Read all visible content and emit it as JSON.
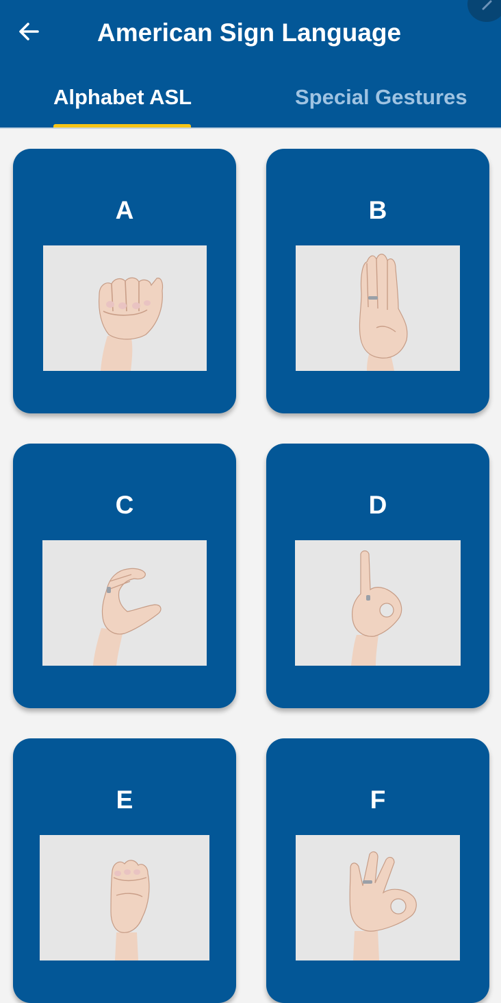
{
  "header": {
    "title": "American Sign Language",
    "back_icon": "arrow-left-icon",
    "corner_icon": "pencil-icon"
  },
  "tabs": [
    {
      "label": "Alphabet ASL",
      "selected": true
    },
    {
      "label": "Special Gestures",
      "selected": false
    }
  ],
  "colors": {
    "app_bar": "#035797",
    "card": "#035797",
    "tab_indicator": "#f5c518",
    "background": "#f3f3f3"
  },
  "cards": [
    {
      "letter": "A",
      "image": "hand-sign-a-image"
    },
    {
      "letter": "B",
      "image": "hand-sign-b-image"
    },
    {
      "letter": "C",
      "image": "hand-sign-c-image"
    },
    {
      "letter": "D",
      "image": "hand-sign-d-image"
    },
    {
      "letter": "E",
      "image": "hand-sign-e-image"
    },
    {
      "letter": "F",
      "image": "hand-sign-f-image"
    }
  ]
}
